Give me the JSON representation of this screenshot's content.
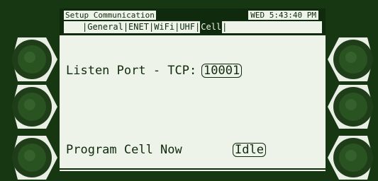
{
  "screen": {
    "title": "Setup Communication",
    "clock": "WED 5:43:40 PM"
  },
  "tabs": [
    {
      "label": "General",
      "active": false
    },
    {
      "label": "ENET",
      "active": false
    },
    {
      "label": "WiFi",
      "active": false
    },
    {
      "label": "UHF",
      "active": false
    },
    {
      "label": "Cell",
      "active": true
    }
  ],
  "settings": {
    "listen_port_label": "Listen Port - TCP:",
    "listen_port_value": "10001",
    "program_cell_label": "Program Cell Now",
    "program_cell_status": "Idle"
  },
  "colors": {
    "bezel": "#173612",
    "lcd_background": "#eef3ea",
    "lcd_foreground": "#0f2a0c"
  },
  "icons": {
    "softkey": "softkey-button-icon"
  }
}
